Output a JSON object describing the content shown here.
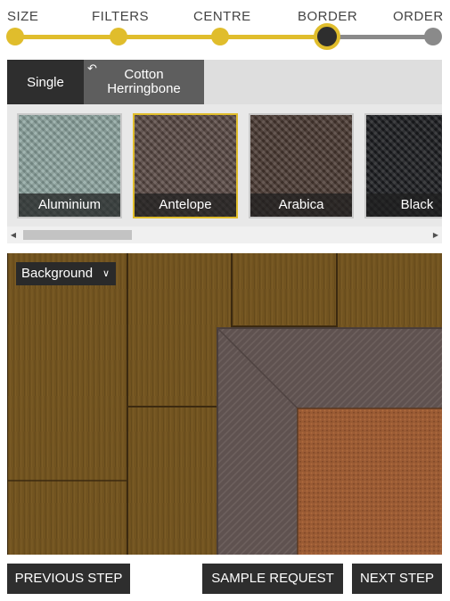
{
  "steps": [
    {
      "label": "SIZE",
      "state": "done"
    },
    {
      "label": "FILTERS",
      "state": "done"
    },
    {
      "label": "CENTRE",
      "state": "done"
    },
    {
      "label": "BORDER",
      "state": "current"
    },
    {
      "label": "ORDER",
      "state": "todo"
    }
  ],
  "tabs": {
    "single": "Single",
    "weave": "Cotton Herringbone",
    "back_icon": "return-arrow-icon"
  },
  "swatches": [
    {
      "name": "Aluminium",
      "color": "#8fa7a2",
      "selected": false
    },
    {
      "name": "Antelope",
      "color": "#5a4a45",
      "selected": true
    },
    {
      "name": "Arabica",
      "color": "#4b3a33",
      "selected": false
    },
    {
      "name": "Black",
      "color": "#1c1d20",
      "selected": false
    }
  ],
  "scrollbar": {
    "left_icon": "scroll-left-icon",
    "right_icon": "scroll-right-icon"
  },
  "preview": {
    "background_label": "Background",
    "dropdown_icon": "chevron-down-icon"
  },
  "buttons": {
    "previous": "PREVIOUS STEP",
    "sample": "SAMPLE REQUEST",
    "next": "NEXT STEP"
  },
  "colors": {
    "accent": "#e0bd2c",
    "dark": "#2e2e2e",
    "inactive": "#8a8a8a"
  }
}
